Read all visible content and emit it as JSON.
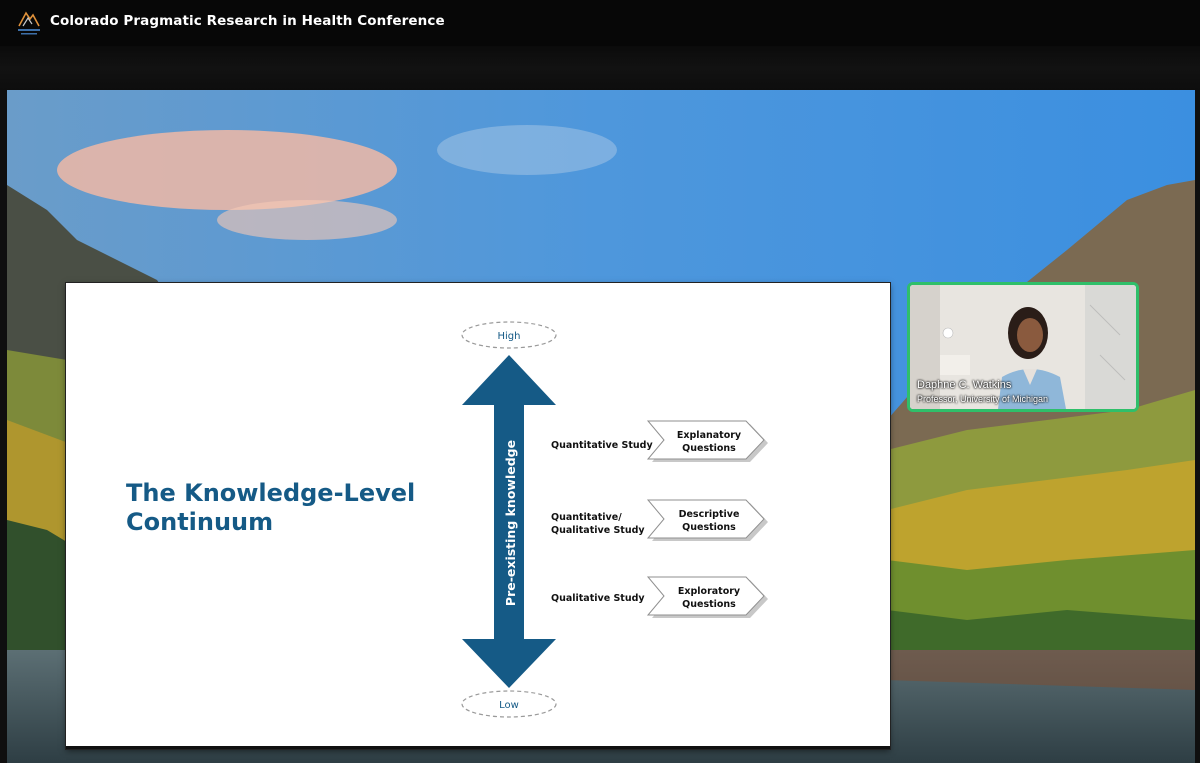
{
  "app": {
    "title": "Colorado Pragmatic Research in Health Conference"
  },
  "slide": {
    "title": "The Knowledge-Level Continuum",
    "high_label": "High",
    "low_label": "Low",
    "axis_label": "Pre-existing knowledge",
    "rows": [
      {
        "study": "Quantitative Study",
        "question_line1": "Explanatory",
        "question_line2": "Questions"
      },
      {
        "study_line1": "Quantitative/",
        "study_line2": "Qualitative Study",
        "question_line1": "Descriptive",
        "question_line2": "Questions"
      },
      {
        "study": "Qualitative Study",
        "question_line1": "Exploratory",
        "question_line2": "Questions"
      }
    ]
  },
  "speaker": {
    "name": "Daphne C. Watkins",
    "role": "Professor, University of Michigan"
  },
  "colors": {
    "accent_blue": "#155a86",
    "arrow_blue": "#155a86",
    "active_speaker_border": "#2fbf6a"
  }
}
